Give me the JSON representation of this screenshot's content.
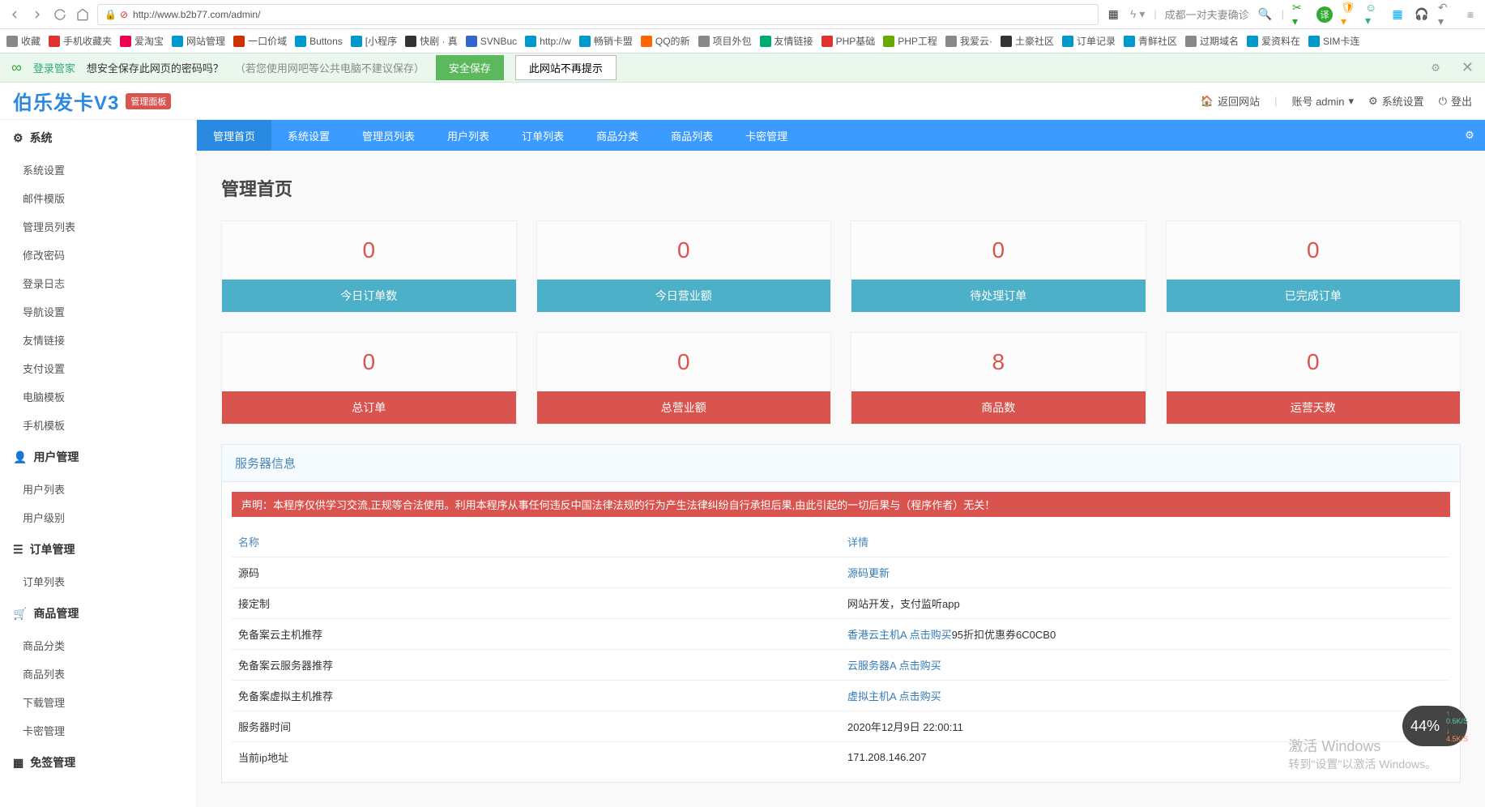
{
  "browser": {
    "url": "http://www.b2b77.com/admin/",
    "search_placeholder": "成都一对夫妻确诊"
  },
  "bookmarks": [
    {
      "label": "收藏",
      "color": "#888"
    },
    {
      "label": "手机收藏夹",
      "color": "#d33"
    },
    {
      "label": "爱淘宝",
      "color": "#e05"
    },
    {
      "label": "网站管理",
      "color": "#09c"
    },
    {
      "label": "一口价域",
      "color": "#c30"
    },
    {
      "label": "Buttons",
      "color": "#09c"
    },
    {
      "label": "[小程序",
      "color": "#09c"
    },
    {
      "label": "快剧 · 真",
      "color": "#333"
    },
    {
      "label": "SVNBuc",
      "color": "#36c"
    },
    {
      "label": "http://w",
      "color": "#09c"
    },
    {
      "label": "畅销卡盟",
      "color": "#09c"
    },
    {
      "label": "QQ的新",
      "color": "#f60"
    },
    {
      "label": "项目外包",
      "color": "#888"
    },
    {
      "label": "友情链接",
      "color": "#0a7"
    },
    {
      "label": "PHP基础",
      "color": "#d33"
    },
    {
      "label": "PHP工程",
      "color": "#6a0"
    },
    {
      "label": "我爱云·",
      "color": "#888"
    },
    {
      "label": "土豪社区",
      "color": "#333"
    },
    {
      "label": "订单记录",
      "color": "#09c"
    },
    {
      "label": "青鲜社区",
      "color": "#09c"
    },
    {
      "label": "过期域名",
      "color": "#888"
    },
    {
      "label": "爱资料在",
      "color": "#09c"
    },
    {
      "label": "SIM卡连",
      "color": "#09c"
    }
  ],
  "notif": {
    "prefix": "登录管家",
    "msg": "想安全保存此网页的密码吗？",
    "hint": "（若您使用网吧等公共电脑不建议保存）",
    "save": "安全保存",
    "nosite": "此网站不再提示"
  },
  "header": {
    "logo": "伯乐发卡V3",
    "badge": "管理面板",
    "back_site": "返回网站",
    "account_prefix": "账号 admin",
    "settings": "系统设置",
    "logout": "登出"
  },
  "topnav": [
    {
      "label": "管理首页",
      "active": true
    },
    {
      "label": "系统设置"
    },
    {
      "label": "管理员列表"
    },
    {
      "label": "用户列表"
    },
    {
      "label": "订单列表"
    },
    {
      "label": "商品分类"
    },
    {
      "label": "商品列表"
    },
    {
      "label": "卡密管理"
    }
  ],
  "sidebar": [
    {
      "title": "系统",
      "icon": "gear",
      "items": [
        "系统设置",
        "邮件模版",
        "管理员列表",
        "修改密码",
        "登录日志",
        "导航设置",
        "友情链接",
        "支付设置",
        "电脑模板",
        "手机模板"
      ]
    },
    {
      "title": "用户管理",
      "icon": "user",
      "items": [
        "用户列表",
        "用户级别"
      ]
    },
    {
      "title": "订单管理",
      "icon": "list",
      "items": [
        "订单列表"
      ]
    },
    {
      "title": "商品管理",
      "icon": "cart",
      "items": [
        "商品分类",
        "商品列表",
        "下载管理",
        "卡密管理"
      ]
    },
    {
      "title": "免签管理",
      "icon": "qr",
      "items": []
    }
  ],
  "page_title": "管理首页",
  "stats_top": [
    {
      "value": "0",
      "label": "今日订单数"
    },
    {
      "value": "0",
      "label": "今日营业额"
    },
    {
      "value": "0",
      "label": "待处理订单"
    },
    {
      "value": "0",
      "label": "已完成订单"
    }
  ],
  "stats_bottom": [
    {
      "value": "0",
      "label": "总订单"
    },
    {
      "value": "0",
      "label": "总营业额"
    },
    {
      "value": "8",
      "label": "商品数"
    },
    {
      "value": "0",
      "label": "运营天数"
    }
  ],
  "server_panel": {
    "title": "服务器信息",
    "disclaimer": "声明：本程序仅供学习交流,正规等合法使用。利用本程序从事任何违反中国法律法规的行为产生法律纠纷自行承担后果,由此引起的一切后果与（程序作者）无关！",
    "head_name": "名称",
    "head_detail": "详情",
    "rows": [
      {
        "k": "源码",
        "v": "源码更新",
        "link": true
      },
      {
        "k": "接定制",
        "v": "网站开发，支付监听app",
        "link": false
      },
      {
        "k": "免备案云主机推荐",
        "v_link": "香港云主机A 点击购买",
        "v_rest": "95折扣优惠券6C0CB0",
        "link": true
      },
      {
        "k": "免备案云服务器推荐",
        "v": "云服务器A 点击购买",
        "link": true
      },
      {
        "k": "免备案虚拟主机推荐",
        "v": "虚拟主机A 点击购买",
        "link": true
      },
      {
        "k": "服务器时间",
        "v": "2020年12月9日 22:00:11",
        "link": false
      },
      {
        "k": "当前ip地址",
        "v": "171.208.146.207",
        "link": false
      }
    ]
  },
  "watermark": {
    "w1": "激活 Windows",
    "w2": "转到\"设置\"以激活 Windows。"
  },
  "speed": {
    "pct": "44%",
    "up": "0.6K/S",
    "down": "4.5K/S"
  }
}
